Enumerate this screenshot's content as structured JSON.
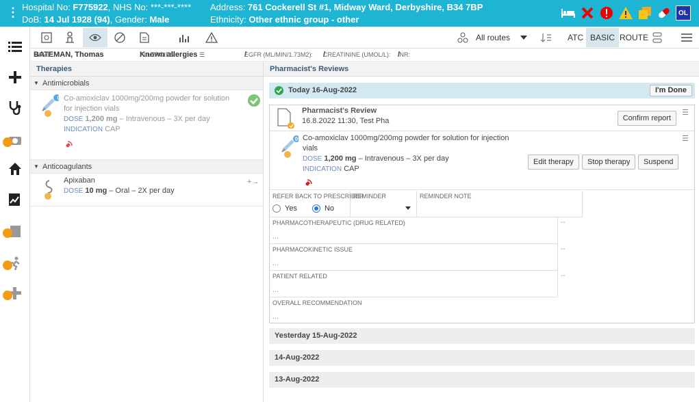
{
  "header": {
    "line1_label": "Hospital No: ",
    "hospital_no": "F775922",
    "nhs_label": ", NHS No: ",
    "nhs_no": "***-***-****",
    "line2_label": "DoB: ",
    "dob": "14 Jul 1928 (94)",
    "gender_label": ", Gender: ",
    "gender": "Male",
    "address_label": "Address: ",
    "address": "761 Cockerell St #1, Midway Ward, Derbyshire, B34 7BP",
    "ethnicity_label": "Ethnicity: ",
    "ethnicity": "Other ethnic group - other",
    "user_initials": "OL"
  },
  "toolbar": {
    "routes_label": "All routes",
    "atc": "ATC",
    "basic": "BASIC",
    "route": "ROUTE"
  },
  "infobar": {
    "name_label": "NAME",
    "name": "BATEMAN, Thomas",
    "allergies_label": "ALLERGIES:",
    "allergies": "Known allergies",
    "egfr_label": "EGFR (ML/MIN/1.73M2):",
    "egfr": "/",
    "creat_label": "CREATININE (UMOL/L):",
    "creat": "/",
    "inr_label": "INR:",
    "inr": "/"
  },
  "therapies": {
    "title": "Therapies",
    "groups": [
      {
        "name": "Antimicrobials",
        "items": [
          {
            "badge": "0",
            "name_line1": "Co-amoxiclav 1000mg/200mg powder for solution",
            "name_line2": "for injection vials",
            "dose_label": "DOSE",
            "dose": "1,200 mg",
            "dose_rest": " – Intravenous – 3X per day",
            "indication_label": "INDICATION",
            "indication": "CAP"
          }
        ]
      },
      {
        "name": "Anticoagulants",
        "items": [
          {
            "name": "Apixaban",
            "dose_label": "DOSE",
            "dose": "10 mg",
            "dose_rest": " – Oral – 2X per day"
          }
        ]
      }
    ]
  },
  "reviews": {
    "title": "Pharmacist's Reviews",
    "today": "Today 16-Aug-2022",
    "done_label": "I'm Done",
    "review_title": "Pharmacist's Review",
    "review_meta": "16.8.2022 11:30, Test Pha",
    "confirm_label": "Confirm report",
    "therapy": {
      "badge": "0",
      "name_line1": "Co-amoxiclav 1000mg/200mg powder for solution for injection",
      "name_line2": "vials",
      "dose_label": "DOSE",
      "dose": "1,200 mg",
      "dose_rest": " – Intravenous – 3X per day",
      "indication_label": "INDICATION",
      "indication": "CAP"
    },
    "edit_label": "Edit therapy",
    "stop_label": "Stop therapy",
    "suspend_label": "Suspend",
    "refer_label": "REFER BACK TO PRESCRIBER",
    "yes": "Yes",
    "no": "No",
    "reminder_label": "REMINDER",
    "reminder_note_label": "REMINDER NOTE",
    "pharmacotherapeutic": "PHARMACOTHERAPEUTIC (DRUG RELATED)",
    "pharmacokinetic": "PHARMACOKINETIC ISSUE",
    "patient_related": "PATIENT RELATED",
    "overall": "OVERALL RECOMMENDATION",
    "placeholder": "...",
    "dash": "--",
    "days": [
      "Yesterday 15-Aug-2022",
      "14-Aug-2022",
      "13-Aug-2022"
    ]
  },
  "colors": {
    "accent": "#1eb5d4",
    "active_bg": "#d7e6ef",
    "done_green": "#5cb85c",
    "lock": "#f39c12"
  }
}
